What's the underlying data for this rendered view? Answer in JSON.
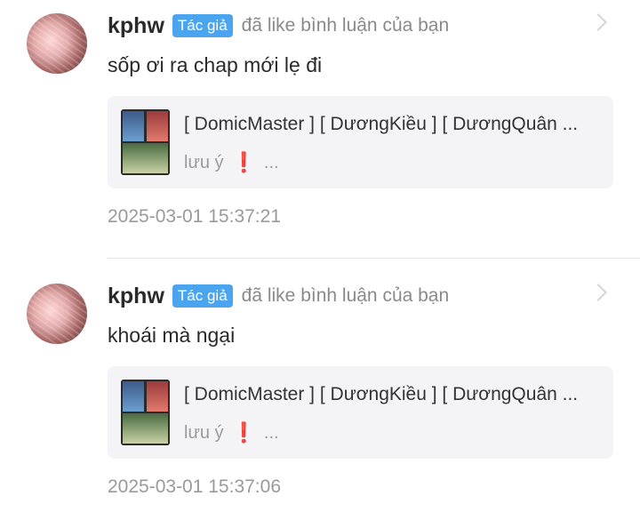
{
  "notifications": [
    {
      "username": "kphw",
      "badge": "Tác giả",
      "action": "đã like bình luận của bạn",
      "comment": "sốp ơi ra chap mới lẹ đi",
      "card": {
        "title": "[ DomicMaster ] [ DươngKiều ] [ DươngQuân ...",
        "subtitle_prefix": "lưu ý",
        "warn": "❗",
        "subtitle_suffix": "..."
      },
      "time": "2025-03-01 15:37:21"
    },
    {
      "username": "kphw",
      "badge": "Tác giả",
      "action": "đã like bình luận của bạn",
      "comment": "khoái mà ngại",
      "card": {
        "title": "[ DomicMaster ] [ DươngKiều ] [ DươngQuân ...",
        "subtitle_prefix": "lưu ý",
        "warn": "❗",
        "subtitle_suffix": "..."
      },
      "time": "2025-03-01 15:37:06"
    }
  ],
  "colors": {
    "badge_bg": "#4aa4ee",
    "warn": "#e53935",
    "muted": "#9a9a9a",
    "card_bg": "#f4f4f6"
  },
  "icons": [
    "chevron-right-icon",
    "exclamation-icon"
  ]
}
